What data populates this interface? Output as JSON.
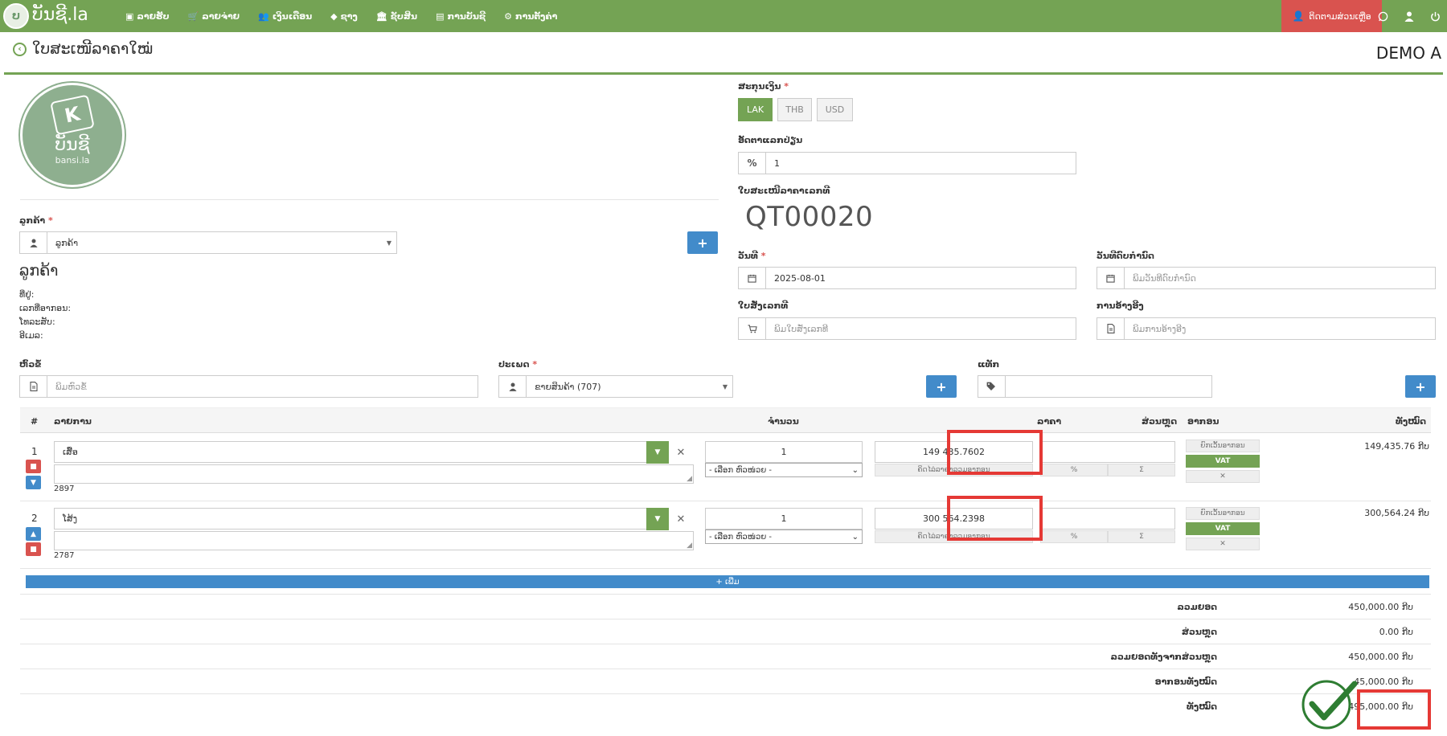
{
  "app": {
    "brand": "ບັນຊີ.la",
    "logo_letter": "ບ"
  },
  "nav": {
    "items": [
      {
        "icon": "▣",
        "label": "ລາຍຮັບ"
      },
      {
        "icon": "🛒",
        "label": "ລາຍຈ່າຍ"
      },
      {
        "icon": "👥",
        "label": "ເງິນເດືອນ"
      },
      {
        "icon": "◆",
        "label": "ຊາງ"
      },
      {
        "icon": "🏛",
        "label": "ຊັບສິນ"
      },
      {
        "icon": "▤",
        "label": "ການບັນຊີ"
      },
      {
        "icon": "⚙",
        "label": "ການຕັ້ງຄ່າ"
      }
    ],
    "contact_label": "ຕິດຕາມສ່ວນເຫຼືອ",
    "contact_icon": "👤"
  },
  "header": {
    "title": "ໃບສະເໜີລາຄາໃໝ່",
    "company": "DEMO A"
  },
  "logo": {
    "letter": "K",
    "line1": "ບັນຊີ",
    "line2": "bansi.la"
  },
  "customer": {
    "label": "ລູກຄ້າ",
    "placeholder": "ລູກຄ້າ",
    "name": "ລູກຄ້າ",
    "address_label": "ທີ່ຢູ່:",
    "tax_label": "ເລກທີ່ອາກອນ:",
    "phone_label": "ໂທລະສັບ:",
    "email_label": "ອີເມລ:"
  },
  "currency": {
    "label": "ສະກຸນເງິນ",
    "options": [
      "LAK",
      "THB",
      "USD"
    ],
    "selected": "LAK"
  },
  "exchange": {
    "label": "ອັດຕາແລກປ່ຽນ",
    "prefix": "%",
    "value": "1"
  },
  "quote": {
    "label": "ໃບສະເໜີລາຄາເລກທີ",
    "number": "QT00020"
  },
  "date": {
    "label": "ວັນທີ",
    "value": "2025-08-01"
  },
  "due_date": {
    "label": "ວັນທີດົບກຳນົດ",
    "placeholder": "ພິມວັນທີດົບກຳນົດ"
  },
  "po": {
    "label": "ໃບສັ່ງເລກທີ",
    "placeholder": "ພິມໃບສັ່ງເລກທີ"
  },
  "reference": {
    "label": "ການອ້າງອີງ",
    "placeholder": "ພິມການອ້າງອີງ"
  },
  "subject": {
    "label": "ຫົວຂໍ້",
    "placeholder": "ພິມຫົວຂໍ້"
  },
  "type": {
    "label": "ປະເພດ",
    "value": "ຂາຍສິນຄ້າ (707)"
  },
  "tags": {
    "label": "ແທັກ",
    "value": ""
  },
  "table": {
    "headers": [
      "#",
      "ລາຍການ",
      "ຈຳນວນ",
      "ລາຄາ",
      "ສ່ວນຫຼຸດ",
      "ອາກອນ",
      "ທັງໝົດ"
    ],
    "unit_placeholder": "- ເລືອກ ຫົວໜ່ວຍ -",
    "price_note": "ຄິດໄລ່ລາຄາລວມອາກອນ",
    "discount_pct": "%",
    "discount_sum": "Σ",
    "tax_exempt": "ຍົກເວັ້ນອາກອນ",
    "tax_vat": "VAT",
    "tax_remove": "✕",
    "rows": [
      {
        "num": "1",
        "item": "ເສື້ອ",
        "code": "2897",
        "qty": "1",
        "price": "149 435.7602",
        "total": "149,435.76 ກີບ"
      },
      {
        "num": "2",
        "item": "ໂສ້ງ",
        "code": "2787",
        "qty": "1",
        "price": "300 564.2398",
        "total": "300,564.24 ກີບ"
      }
    ],
    "add_label": "+ ເພີ່ມ"
  },
  "summary": [
    {
      "label": "ລວມຍອດ",
      "value": "450,000.00 ກີບ"
    },
    {
      "label": "ສ່ວນຫຼຸດ",
      "value": "0.00 ກີບ"
    },
    {
      "label": "ລວມຍອດທັງຈາກສ່ວນຫຼຸດ",
      "value": "450,000.00 ກີບ"
    },
    {
      "label": "ອາກອນທັງໝົດ",
      "value": "45,000.00 ກີບ"
    },
    {
      "label": "ທັງໝົດ",
      "value": "495,000.00 ກີບ"
    }
  ],
  "colors": {
    "brand_green": "#74a354",
    "accent_blue": "#428bca",
    "alert_red": "#d9534f",
    "highlight_red": "#e53935"
  }
}
